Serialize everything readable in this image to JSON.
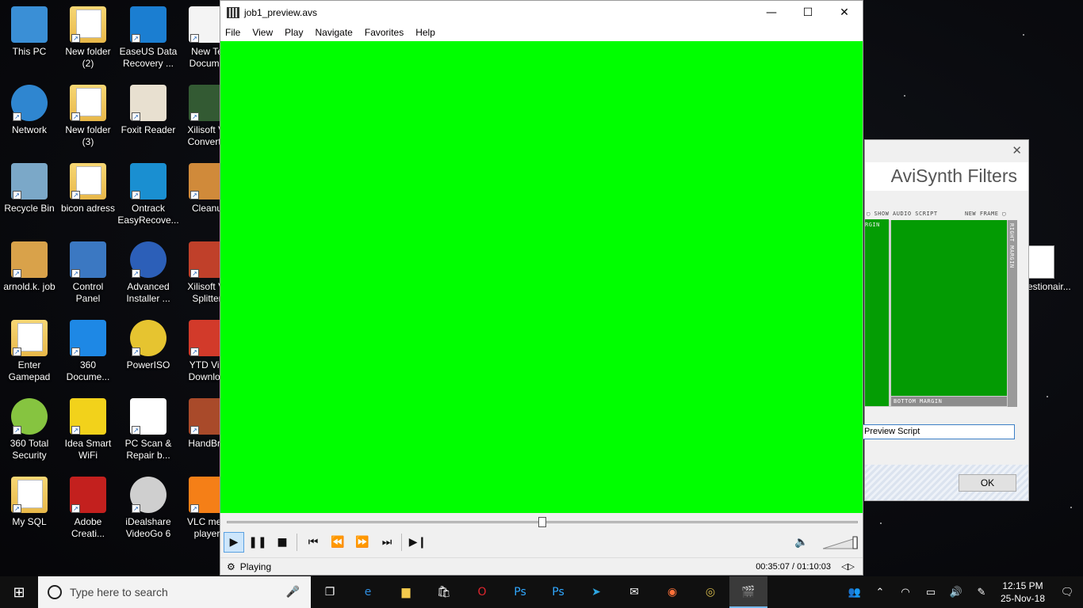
{
  "desktop": {
    "icons": [
      {
        "label": "This PC"
      },
      {
        "label": "New folder\n(2)"
      },
      {
        "label": "EaseUS Data\nRecovery ..."
      },
      {
        "label": "New Te\nDocume"
      },
      {
        "label": "Network"
      },
      {
        "label": "New folder\n(3)"
      },
      {
        "label": "Foxit Reader"
      },
      {
        "label": "Xilisoft Vi\nConverte"
      },
      {
        "label": "Recycle Bin"
      },
      {
        "label": "bicon adress"
      },
      {
        "label": "Ontrack\nEasyRecove..."
      },
      {
        "label": "Cleanu"
      },
      {
        "label": "arnold.k. job"
      },
      {
        "label": "Control\nPanel"
      },
      {
        "label": "Advanced\nInstaller ..."
      },
      {
        "label": "Xilisoft Vi\nSplitter"
      },
      {
        "label": "Enter\nGamepad"
      },
      {
        "label": "360\nDocume..."
      },
      {
        "label": "PowerISO"
      },
      {
        "label": "YTD Vid\nDownloa"
      },
      {
        "label": "360 Total\nSecurity"
      },
      {
        "label": "Idea Smart\nWiFi"
      },
      {
        "label": "PC Scan &\nRepair b..."
      },
      {
        "label": "HandBra"
      },
      {
        "label": "My SQL"
      },
      {
        "label": "Adobe\nCreati..."
      },
      {
        "label": "iDealshare\nVideoGo 6"
      },
      {
        "label": "VLC med\nplayer"
      }
    ],
    "right_doc_label": "estionair..."
  },
  "player": {
    "title": "job1_preview.avs",
    "menu": [
      "File",
      "View",
      "Play",
      "Navigate",
      "Favorites",
      "Help"
    ],
    "video_color": "#00ff00",
    "seek_progress": 0.5,
    "status": "Playing",
    "time": "00:35:07 / 01:10:03"
  },
  "avisynth": {
    "title": "AviSynth Filters",
    "show_audio_script": "SHOW AUDIO SCRIPT",
    "new_frame": "NEW FRAME",
    "margin_label": "RGIN",
    "right_margin": "RIGHT MARGIN",
    "bottom_margin": "BOTTOM MARGIN",
    "select_value": "Preview Script",
    "ok_label": "OK"
  },
  "taskbar": {
    "search_placeholder": "Type here to search",
    "time": "12:15 PM",
    "date": "25-Nov-18"
  }
}
